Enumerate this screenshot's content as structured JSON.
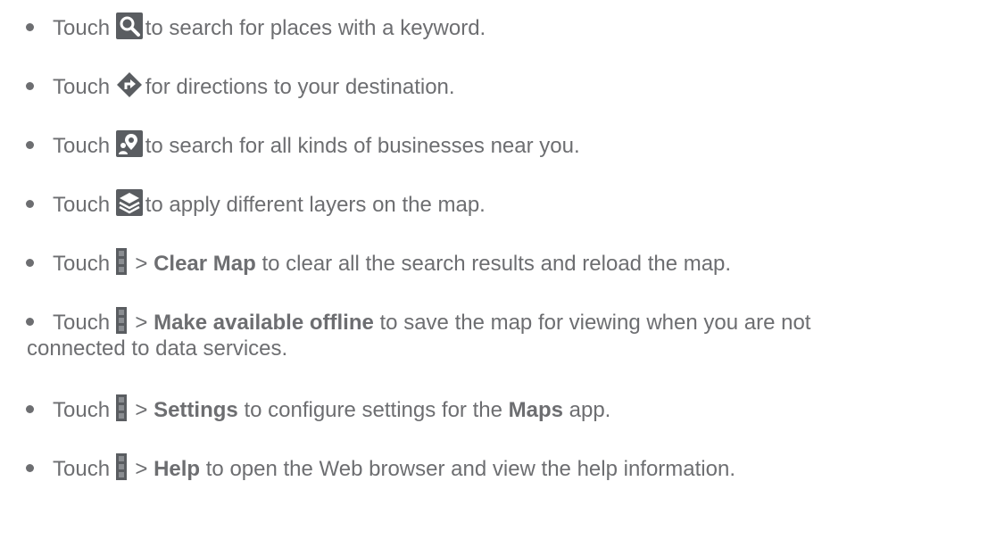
{
  "items": [
    {
      "pre": "Touch",
      "icon": "search-icon",
      "post": "to search for places with a keyword."
    },
    {
      "pre": "Touch",
      "icon": "directions-icon",
      "post": "for directions to your destination."
    },
    {
      "pre": "Touch",
      "icon": "local-places-icon",
      "post": "to search for all kinds of businesses near you."
    },
    {
      "pre": "Touch",
      "icon": "layers-icon",
      "post": "to apply different layers on the map."
    },
    {
      "pre": "Touch",
      "icon": "menu-icon",
      "sep": ">",
      "bold": "Clear Map",
      "post": "to clear all the search results and reload the map."
    },
    {
      "pre": "Touch",
      "icon": "menu-icon",
      "sep": ">",
      "bold": "Make available offline",
      "post": "to save the map for viewing when you are not",
      "post2": "connected to data services."
    },
    {
      "pre": "Touch",
      "icon": "menu-icon",
      "sep": ">",
      "bold": "Settings",
      "post": "to configure settings for the",
      "bold2": "Maps",
      "post3": "app."
    },
    {
      "pre": "Touch",
      "icon": "menu-icon",
      "sep": ">",
      "bold": "Help",
      "post": "to open the Web browser and view the help information."
    }
  ]
}
